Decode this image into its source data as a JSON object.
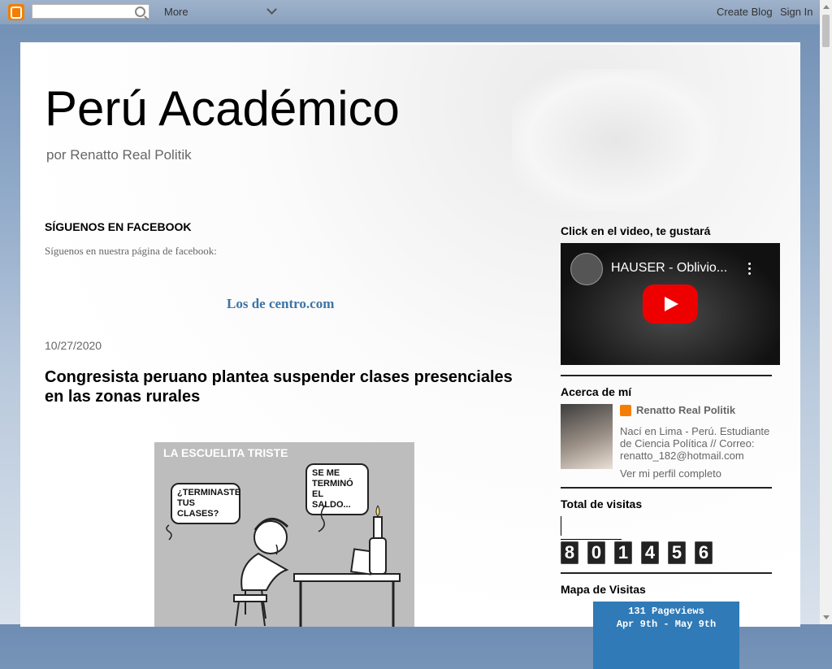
{
  "navbar": {
    "more_label": "More",
    "create_blog_label": "Create Blog",
    "sign_in_label": "Sign In"
  },
  "header": {
    "title": "Perú Académico",
    "description": "por Renatto Real Politik"
  },
  "facebook": {
    "heading": "SÍGUENOS EN FACEBOOK",
    "text": "Síguenos en nuestra página de facebook:",
    "link": "Los de centro.com"
  },
  "post": {
    "date": "10/27/2020",
    "title": "Congresista peruano plantea suspender clases presenciales en las zonas rurales",
    "image": {
      "title": "LA ESCUELITA TRISTE",
      "bubble_left": "¿TERMINASTE TUS CLASES?",
      "bubble_right": "SE ME TERMINÓ EL SALDO..."
    }
  },
  "sidebar": {
    "video": {
      "heading": "Click en el video, te gustará",
      "title": "HAUSER - Oblivio..."
    },
    "about": {
      "heading": "Acerca de mí",
      "name": "Renatto Real Politik",
      "bio": "Nací en Lima - Perú. Estudiante de Ciencia Política // Correo: renatto_182@hotmail.com",
      "profile_link": "Ver mi perfil completo"
    },
    "visits": {
      "heading": "Total de visitas",
      "digits": [
        "8",
        "0",
        "1",
        "4",
        "5",
        "6"
      ]
    },
    "map": {
      "heading": "Mapa de Visitas",
      "line1": "131 Pageviews",
      "line2": "Apr 9th - May 9th"
    }
  },
  "colors": {
    "blogger_orange": "#f57d00",
    "link_blue": "#3d74a5",
    "youtube_red": "#e00000",
    "map_blue": "#2f7ab7"
  }
}
